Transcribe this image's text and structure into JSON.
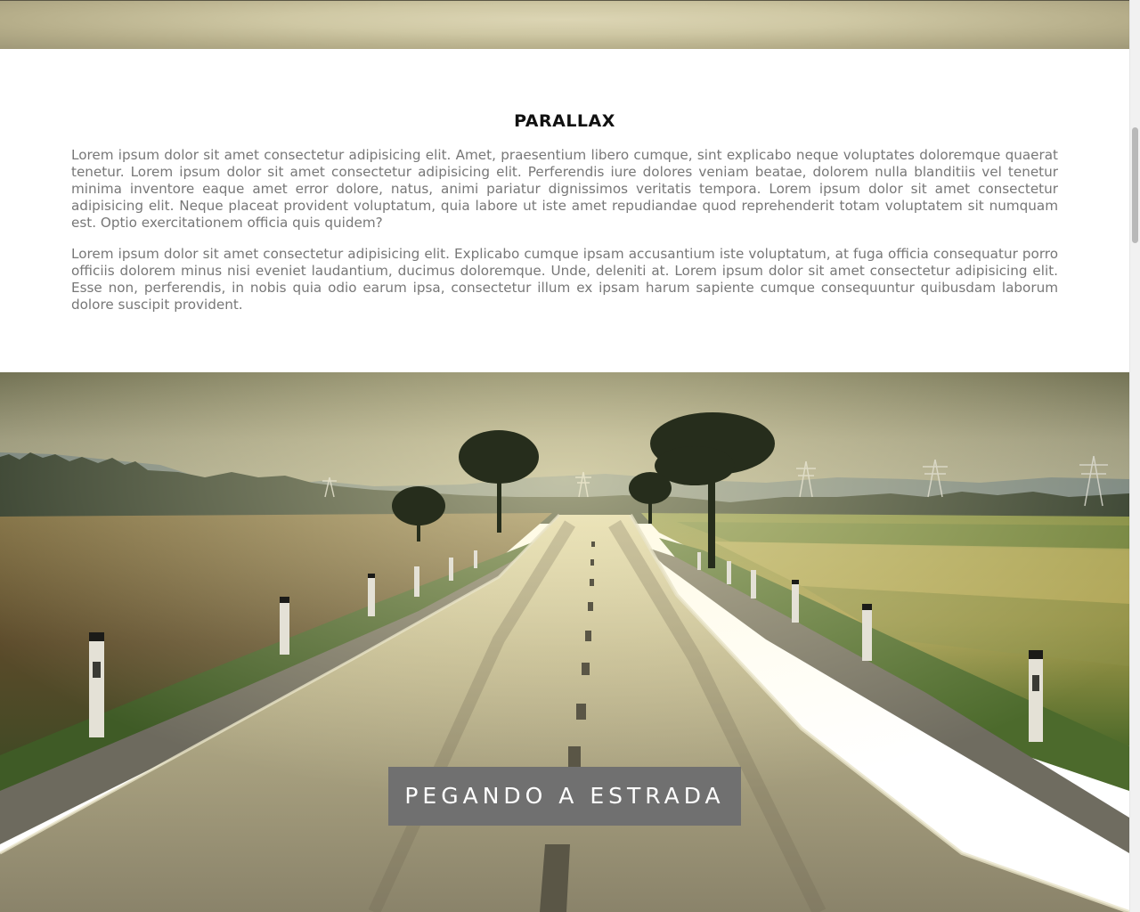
{
  "section": {
    "title": "PARALLAX",
    "paragraphs": [
      "Lorem ipsum dolor sit amet consectetur adipisicing elit. Amet, praesentium libero cumque, sint explicabo neque voluptates doloremque quaerat tenetur. Lorem ipsum dolor sit amet consectetur adipisicing elit. Perferendis iure dolores veniam beatae, dolorem nulla blanditiis vel tenetur minima inventore eaque amet error dolore, natus, animi pariatur dignissimos veritatis tempora. Lorem ipsum dolor sit amet consectetur adipisicing elit. Neque placeat provident voluptatum, quia labore ut iste amet repudiandae quod reprehenderit totam voluptatem sit numquam est. Optio exercitationem officia quis quidem?",
      "Lorem ipsum dolor sit amet consectetur adipisicing elit. Explicabo cumque ipsam accusantium iste voluptatum, at fuga officia consequatur porro officiis dolorem minus nisi eveniet laudantium, ducimus doloremque. Unde, deleniti at. Lorem ipsum dolor sit amet consectetur adipisicing elit. Esse non, perferendis, in nobis quia odio earum ipsa, consectetur illum ex ipsam harum sapiente cumque consequuntur quibusdam laborum dolore suscipit provident."
    ]
  },
  "parallax_road": {
    "caption": "PEGANDO A ESTRADA"
  },
  "colors": {
    "caption_bg": "#707070",
    "caption_text": "#ffffff",
    "title": "#111111",
    "body_text": "#777777"
  }
}
